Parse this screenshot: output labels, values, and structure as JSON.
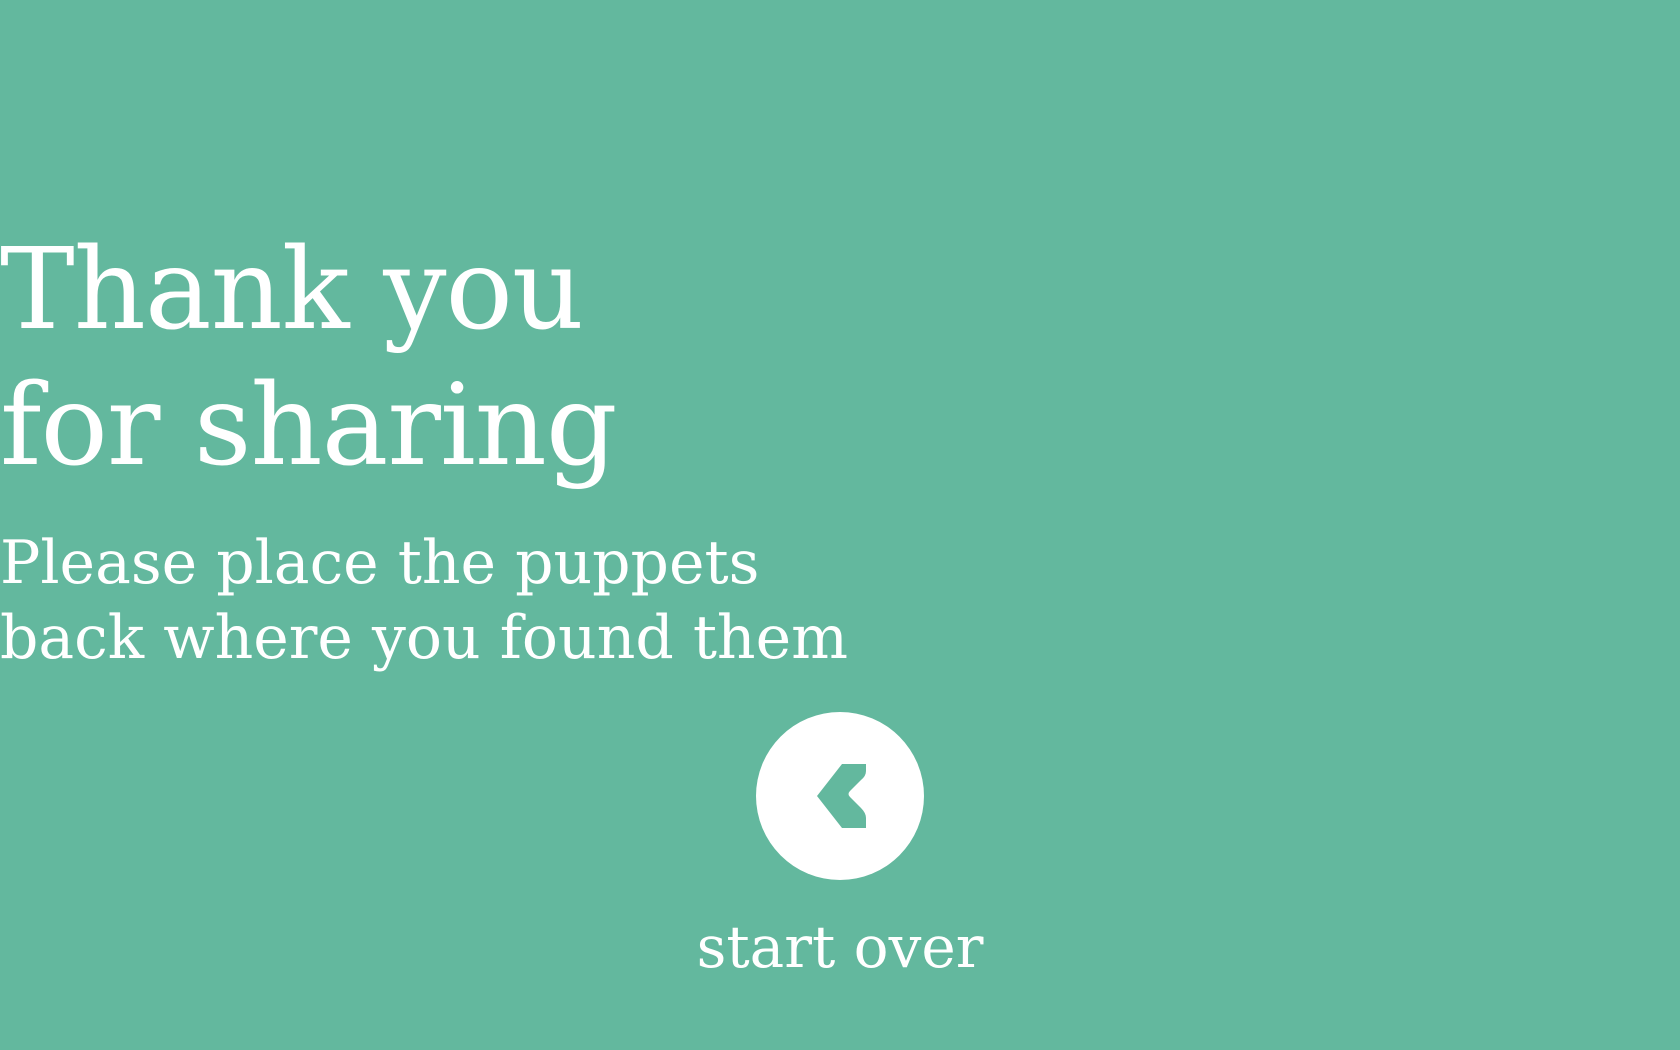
{
  "theme": {
    "background": "#63b89e",
    "text": "#ffffff",
    "button_fill": "#ffffff",
    "icon_color": "#63b89e"
  },
  "headline": {
    "line1": "Thank you",
    "line2": "for sharing"
  },
  "message": {
    "line1": "Please place the puppets",
    "line2": "back where you found them"
  },
  "start_over": {
    "icon": "chevron-left-icon",
    "label": "start over"
  }
}
